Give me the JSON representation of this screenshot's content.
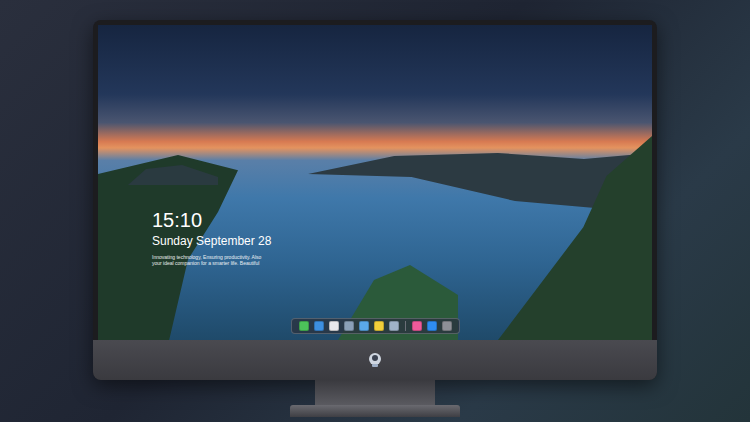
{
  "lock_screen": {
    "time": "15:10",
    "date": "Sunday September 28",
    "message": "Innovating technology, Ensuring productivity. Also your ideal companion for a smarter life. Beautiful"
  },
  "dock": {
    "items": [
      {
        "kind": "app",
        "color": "#4cc35a"
      },
      {
        "kind": "app",
        "color": "#3d8fe0"
      },
      {
        "kind": "app",
        "color": "#e8e8ec"
      },
      {
        "kind": "app",
        "color": "#8aa0b8"
      },
      {
        "kind": "app",
        "color": "#5aa8e8"
      },
      {
        "kind": "app",
        "color": "#f2cf3a"
      },
      {
        "kind": "app",
        "color": "#9fb3c8"
      },
      {
        "kind": "divider",
        "color": "#6b6f78"
      },
      {
        "kind": "app",
        "color": "#f05a9a"
      },
      {
        "kind": "app",
        "color": "#2f8cf0"
      },
      {
        "kind": "app",
        "color": "#8e9097"
      }
    ]
  }
}
